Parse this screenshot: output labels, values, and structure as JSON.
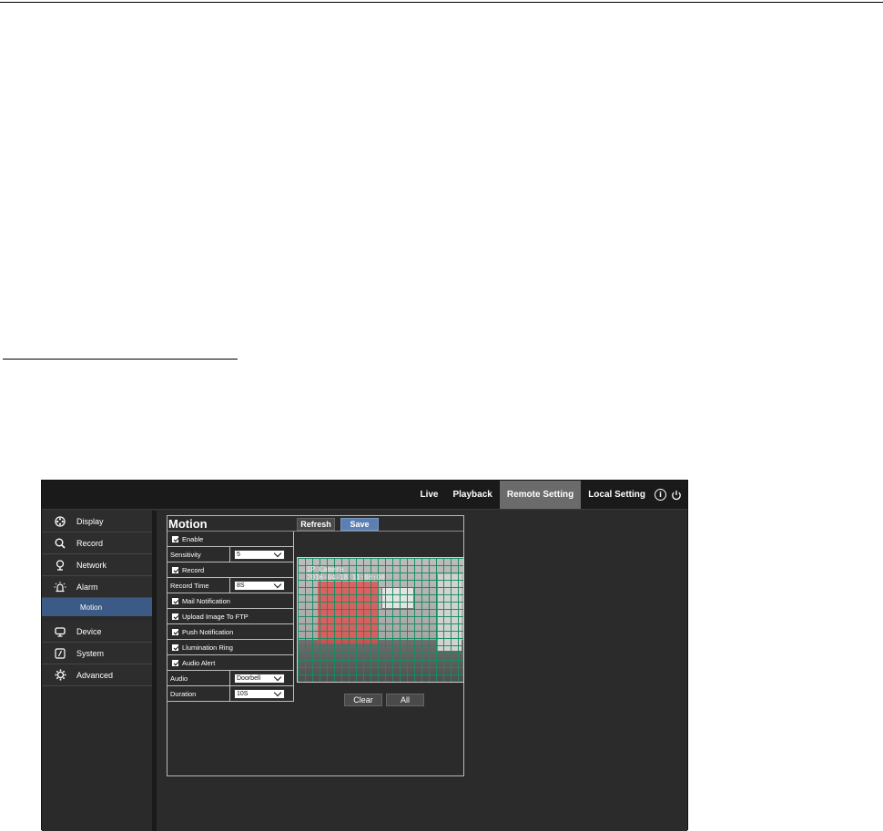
{
  "topnav": {
    "items": [
      "Live",
      "Playback",
      "Remote Setting",
      "Local Setting"
    ],
    "active": "Remote Setting"
  },
  "sidebar": {
    "items": [
      {
        "label": "Display",
        "icon": "display-icon"
      },
      {
        "label": "Record",
        "icon": "search-icon"
      },
      {
        "label": "Network",
        "icon": "network-icon"
      },
      {
        "label": "Alarm",
        "icon": "alarm-icon"
      },
      {
        "label": "Device",
        "icon": "device-icon"
      },
      {
        "label": "System",
        "icon": "system-icon"
      },
      {
        "label": "Advanced",
        "icon": "gear-icon"
      }
    ],
    "sub_item": "Motion"
  },
  "panel": {
    "title": "Motion",
    "refresh_label": "Refresh",
    "save_label": "Save",
    "enable_label": "Enable",
    "sensitivity_label": "Sensitivity",
    "sensitivity_value": "5",
    "record_label": "Record",
    "record_time_label": "Record Time",
    "record_time_value": "8S",
    "mail_notification_label": "Mail Notification",
    "upload_ftp_label": "Upload Image To FTP",
    "push_notification_label": "Push Notification",
    "illumination_ring_label": "Llumination Ring",
    "audio_alert_label": "Audio Alert",
    "audio_label": "Audio",
    "audio_value": "Doorbell",
    "duration_label": "Duration",
    "duration_value": "10S",
    "clear_label": "Clear",
    "all_label": "All",
    "osd_line1": "IP Camera",
    "osd_line2": "2016-04-18 11:08:00"
  },
  "colors": {
    "topbar_bg": "#1a1a1a",
    "active_tab": "#6b6b6b",
    "sidebar_active": "#3b5a86",
    "save_button": "#5b7fb2",
    "grid_line": "#168c5f",
    "motion_region": "#e44a4a"
  }
}
